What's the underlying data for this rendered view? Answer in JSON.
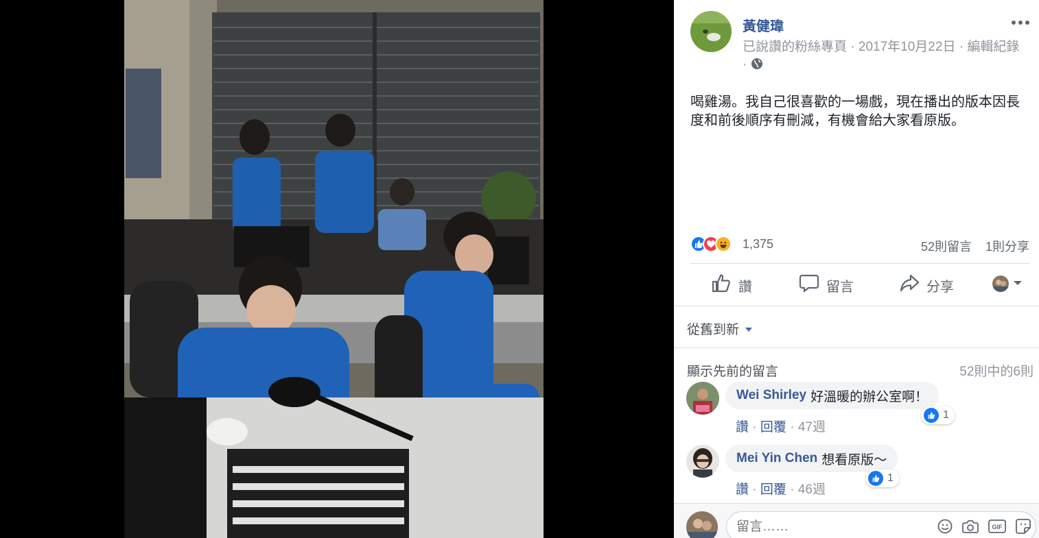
{
  "post": {
    "author": "黃健瑋",
    "meta_prefix": "已說讚的粉絲專頁",
    "meta_date": "2017年10月22日",
    "meta_edit": "編輯紀錄",
    "text": "喝雞湯。我自己很喜歡的一場戲，現在播出的版本因長度和前後順序有刪減，有機會給大家看原版。"
  },
  "stats": {
    "reactions_count": "1,375",
    "comments_count": "52則留言",
    "shares_count": "1則分享"
  },
  "actions": {
    "like_label": "讚",
    "comment_label": "留言",
    "share_label": "分享"
  },
  "comments_section": {
    "sort_label": "從舊到新",
    "previous_label": "顯示先前的留言",
    "count_label": "52則中的6則"
  },
  "comments": [
    {
      "name": "Wei Shirley",
      "text": "好溫暖的辦公室啊！",
      "likes": "1",
      "like_action": "讚",
      "reply_action": "回覆",
      "time": "47週"
    },
    {
      "name": "Mei Yin Chen",
      "text": "想看原版～",
      "likes": "1",
      "like_action": "讚",
      "reply_action": "回覆",
      "time": "46週"
    }
  ],
  "composer": {
    "placeholder": "留言……"
  },
  "icons": [
    "more-icon",
    "globe-icon",
    "like-reaction-icon",
    "love-reaction-icon",
    "haha-reaction-icon",
    "thumbs-up-icon",
    "speech-bubble-icon",
    "share-arrow-icon",
    "chevron-down-icon",
    "emoji-icon",
    "camera-icon",
    "gif-icon",
    "sticker-icon"
  ],
  "colors": {
    "link_blue": "#365899",
    "like_blue": "#1877f2",
    "love_red": "#f33e58",
    "haha_yellow": "#f7b125",
    "muted_text": "#90949c"
  }
}
